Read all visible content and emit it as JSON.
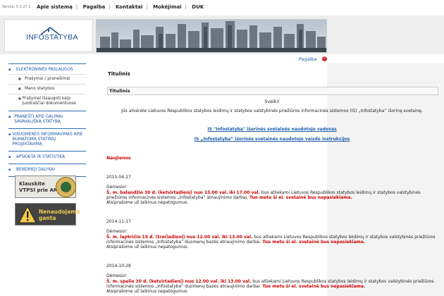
{
  "header": {
    "version": "Versija: 5.0.27.1",
    "nav": [
      "Apie sistemą",
      "Pagalba",
      "Kontaktai",
      "Mokėjimai",
      "DUK"
    ],
    "logo_text": "INFOSTATYBA"
  },
  "help": {
    "label": "Pagalba",
    "icon": "help-icon"
  },
  "sidebar": {
    "items": [
      {
        "label": "ELEKTRONINĖS PASLAUGOS",
        "sub": [
          "Prašymai / pranešimai",
          "Mano statybos",
          "Prašymai išsaugoti kaip juodraščiai dokumentuose"
        ]
      },
      {
        "label": "PRANEŠTI APIE GALIMAI SAVAVALIŠKĄ STATYBĄ",
        "sub": []
      },
      {
        "label": "VISUOMENĖS INFORMAVIMAS APIE NUMATOMĄ STATINIŲ PROJEKTAVIMĄ",
        "sub": []
      },
      {
        "label": "APSKAITA IR STATISTIKA",
        "sub": []
      },
      {
        "label": "BENDRIEJI DALYKAI",
        "sub": []
      }
    ]
  },
  "ads": [
    {
      "text_line1": "Klauskite",
      "text_line2": "VTPSI prie AM"
    },
    {
      "text_line1": "Nenaudojama",
      "text_line2": "ganta"
    }
  ],
  "main": {
    "page_title": "Titulinis",
    "box_title": "Titulinis",
    "welcome": "Sveiki!",
    "intro": "Jūs atvėrėte Lietuvos Respublikos statybos leidimų ir statybos valstybinės priežiūros informacinės sistemos (IS) „Infostatyba“ išorinę svetainę.",
    "link1": "IS \"Infostatyba\" išorinės svetainės naudotojo vadovas",
    "link2": "IS „Infostatyba“ išorinės svetainės naudotojo vaizdo instrukcijos",
    "news_heading": "Naujienos",
    "news": [
      {
        "date": "2015-04-27",
        "greeting": "Dėmesio!",
        "highlight": "Š. m. balandžio 30 d. (ketvirtadienį) nuo 15.00 val. iki 17.00 val.",
        "body": "bus atliekami Lietuvos Respublikos statybos leidimų ir statybos valstybinės priežiūros informacinės sistemos „Infostatyba“ atnaujinimo darbai.",
        "warning": "Tuo metu ši el. svetainė bus nepasiekiama.",
        "footer": "Atsiprašome už laikinus nepatogumus."
      },
      {
        "date": "2014-11-17",
        "greeting": "Dėmesio!",
        "highlight": "Š. m. lapkričio 19 d. (trečiadienį) nuo 12.00 val. iki 13.00 val.",
        "body": "bus atliekami Lietuvos Respublikos statybos leidimų ir statybos valstybinės priežiūros informacinės sistemos „Infostatyba“ duomenų bazės atnaujinimo darbai.",
        "warning": "Tuo metu ši el. svetainė bus nepasiekiama.",
        "footer": "Atsiprašome už laikinus nepatogumus."
      },
      {
        "date": "2014-10-28",
        "greeting": "Dėmesio!",
        "highlight": "Š. m. spalio 30 d. (ketvirtadienį) nuo 12.00 val. iki 13.00 val.",
        "body": "bus atliekami Lietuvos Respublikos statybos leidimų ir statybos valstybinės priežiūros informacinės sistemos „Infostatyba“ duomenų bazės atnaujinimo darbai.",
        "warning": "Tuo metu ši el. svetainė bus nepasiekiama.",
        "footer": "Atsiprašome už laikinus nepatogumus."
      }
    ]
  }
}
